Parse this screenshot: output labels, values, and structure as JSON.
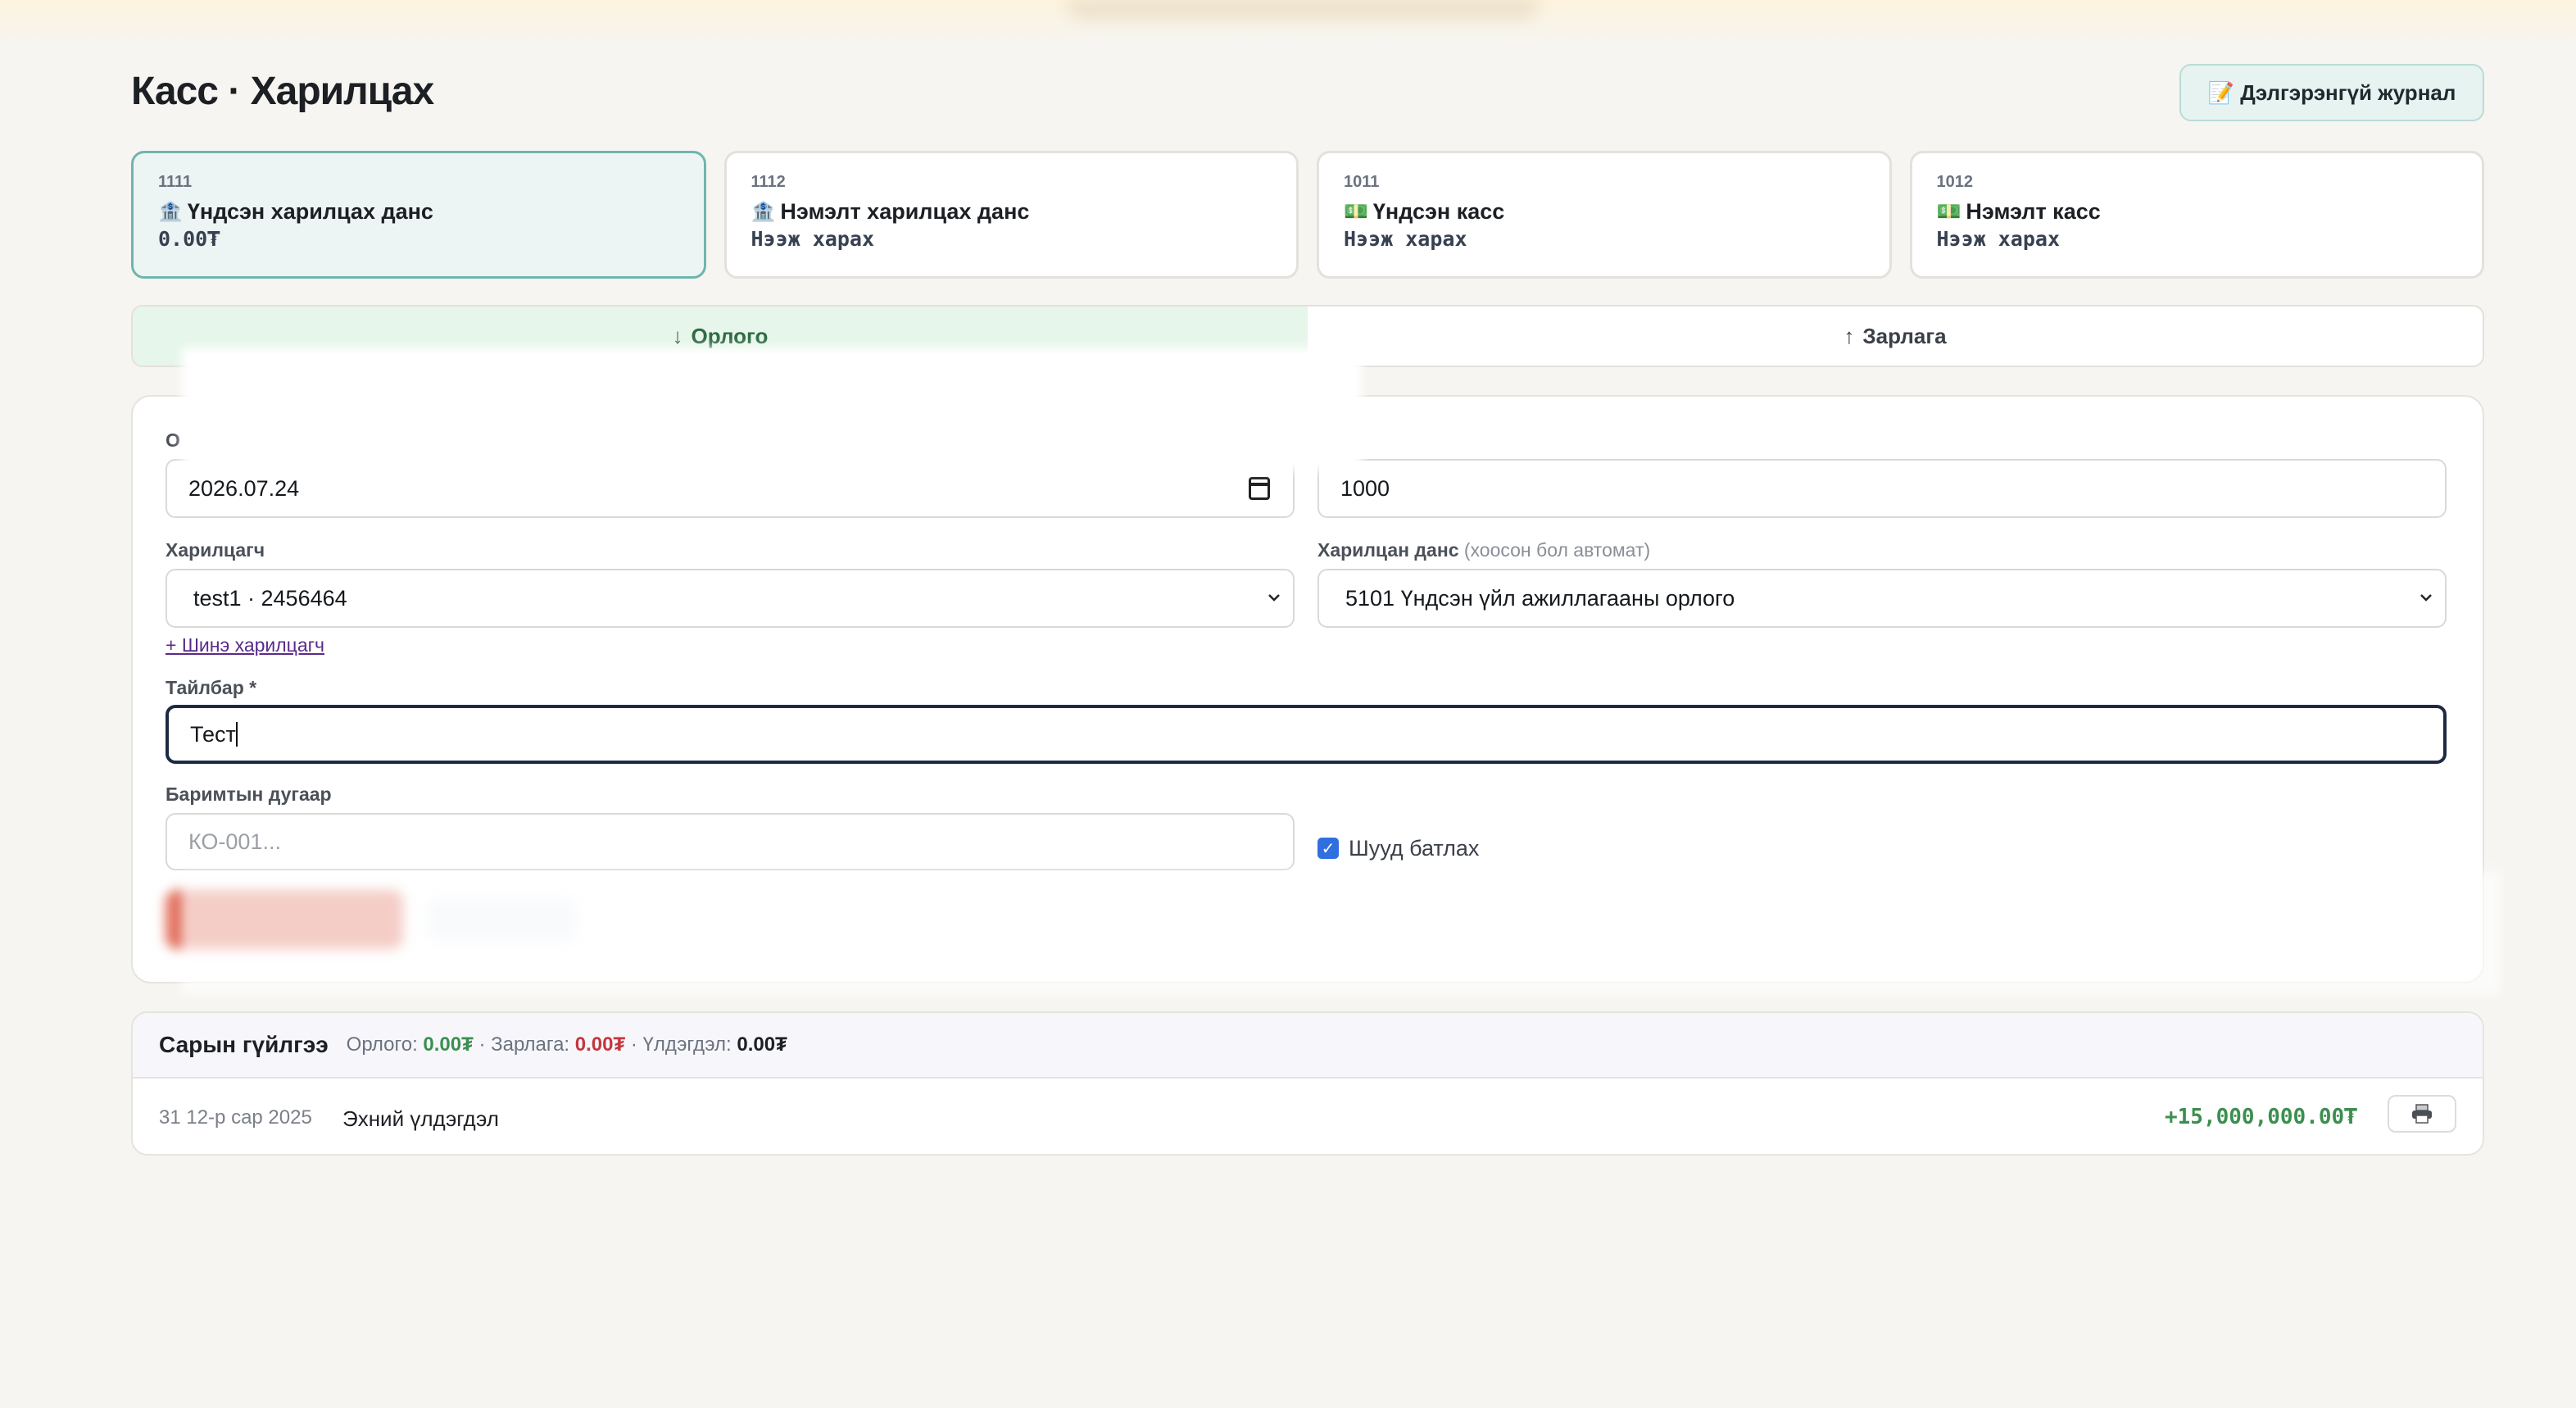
{
  "page": {
    "title": "Касс · Харилцах",
    "journal_button": "📝 Дэлгэрэнгүй журнал"
  },
  "accounts": [
    {
      "code": "1111",
      "icon": "bank-icon",
      "emoji": "🏦",
      "name": "Үндсэн харилцах данс",
      "balance": "0.00₮",
      "active": true
    },
    {
      "code": "1112",
      "icon": "bank-icon",
      "emoji": "🏦",
      "name": "Нэмэлт харилцах данс",
      "balance": "Нээж харах",
      "active": false
    },
    {
      "code": "1011",
      "icon": "cash-icon",
      "emoji": "💵",
      "name": "Үндсэн касс",
      "balance": "Нээж харах",
      "active": false
    },
    {
      "code": "1012",
      "icon": "cash-icon",
      "emoji": "💵",
      "name": "Нэмэлт касс",
      "balance": "Нээж харах",
      "active": false
    }
  ],
  "tabs": {
    "income": {
      "arrow": "↓",
      "label": "Орлого"
    },
    "expense": {
      "arrow": "↑",
      "label": "Зарлага"
    }
  },
  "form": {
    "date_label_partial": "О",
    "date_value": "2026.07.24",
    "amount_label_partial": "₮) *",
    "amount_value": "1000",
    "customer_label": "Харилцагч",
    "customer_value": "test1 · 2456464",
    "new_customer_link": "+ Шинэ харилцагч",
    "counter_account_label": "Харилцан данс",
    "counter_account_hint": "(хоосон бол автомат)",
    "counter_account_value": "5101 Үндсэн үйл ажиллагааны орлого",
    "description_label": "Тайлбар *",
    "description_value": "Тест",
    "doc_number_label": "Баримтын дугаар",
    "doc_number_placeholder": "КО-001...",
    "approve_label": "Шууд батлах",
    "approve_checked": true
  },
  "transactions": {
    "title": "Сарын гүйлгээ",
    "income_label": "Орлого:",
    "income_value": "0.00₮",
    "expense_label": "Зарлага:",
    "expense_value": "0.00₮",
    "balance_label": "Үлдэгдэл:",
    "balance_value": "0.00₮",
    "separator": "·",
    "rows": [
      {
        "date": "31 12-р сар 2025",
        "description": "Эхний үлдэгдэл",
        "amount": "+15,000,000.00₮"
      }
    ]
  },
  "colors": {
    "accent_teal": "#6fb5ad",
    "income_green": "#3c8f4f",
    "expense_red": "#c5363d",
    "save_button": "#e2725e"
  }
}
